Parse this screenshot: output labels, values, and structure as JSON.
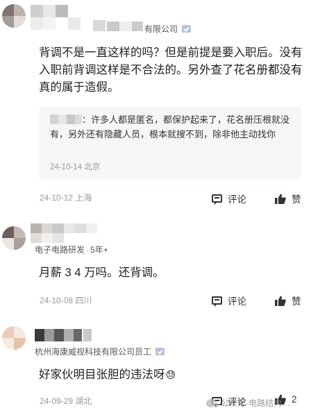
{
  "comments": [
    {
      "company": "有限公司",
      "content": "背调不是一直这样的吗？但是前提是要入职后。没有入职前背调这样是不合法的。另外查了花名册都没有真的属于造假。",
      "reply": {
        "text_suffix": "：许多人都是匿名，都保护起来了，花名册压根就没有，另外还有隐藏人员，根本就搜不到，除非他主动找你",
        "date": "24-10-14 北京"
      },
      "date": "24-10-12 上海",
      "comment_label": "评论",
      "like_label": "赞"
    },
    {
      "role": "电子电路研发",
      "years": "5年+",
      "content": "月薪 3 4 万吗。还背调。",
      "date": "24-10-08 四川",
      "comment_label": "评论",
      "like_label": "赞"
    },
    {
      "company": "杭州海康威视科技有限公司员工",
      "content": "好家伙明目张胆的违法呀",
      "emoji": "😓",
      "date": "24-09-29 湖北",
      "comment_label": "评论",
      "like_count": "2"
    }
  ],
  "watermark": "公众号·电路结构…",
  "icons": {
    "verify": "verified-badge-icon",
    "comment": "comment-icon",
    "like": "thumbs-up-icon",
    "watermark": "wechat-icon"
  },
  "colors": {
    "text": "#1f1f1f",
    "meta": "#555555",
    "date": "#9a9a9a",
    "quote_bg": "#f5f6f8"
  }
}
